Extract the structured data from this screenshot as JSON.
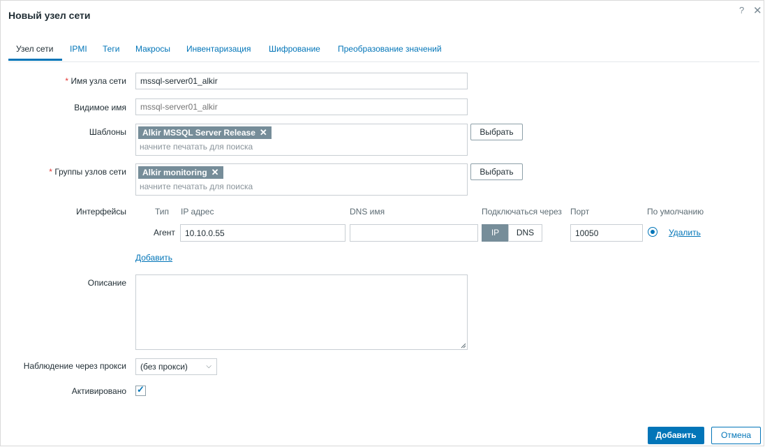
{
  "dialog": {
    "title": "Новый узел сети",
    "help_icon": "question-icon",
    "close_icon": "close-icon"
  },
  "tabs": [
    {
      "label": "Узел сети",
      "active": true
    },
    {
      "label": "IPMI"
    },
    {
      "label": "Теги"
    },
    {
      "label": "Макросы"
    },
    {
      "label": "Инвентаризация"
    },
    {
      "label": "Шифрование"
    },
    {
      "label": "Преобразование значений"
    }
  ],
  "form": {
    "required_mark": "*",
    "host_name": {
      "label": "Имя узла сети",
      "value": "mssql-server01_alkir"
    },
    "visible_name": {
      "label": "Видимое имя",
      "value": "mssql-server01_alkir"
    },
    "templates": {
      "label": "Шаблоны",
      "chip": "Alkir MSSQL Server Release",
      "placeholder": "начните печатать для поиска",
      "select_button": "Выбрать"
    },
    "host_groups": {
      "label": "Группы узлов сети",
      "chip": "Alkir monitoring",
      "placeholder": "начните печатать для поиска",
      "select_button": "Выбрать"
    },
    "interfaces": {
      "label": "Интерфейсы",
      "headers": {
        "type": "Тип",
        "ip": "IP адрес",
        "dns": "DNS имя",
        "connect": "Подключаться через",
        "port": "Порт",
        "default": "По умолчанию"
      },
      "row": {
        "type": "Агент",
        "ip": "10.10.0.55",
        "dns": "",
        "connect_ip": "IP",
        "connect_dns": "DNS",
        "connect_selected": "IP",
        "port": "10050",
        "remove": "Удалить"
      },
      "add_link": "Добавить"
    },
    "description": {
      "label": "Описание",
      "value": ""
    },
    "proxy": {
      "label": "Наблюдение через прокси",
      "value": "(без прокси)"
    },
    "enabled": {
      "label": "Активировано",
      "checked": true
    }
  },
  "footer": {
    "add_button": "Добавить",
    "cancel_button": "Отмена"
  },
  "colors": {
    "accent": "#0275b8",
    "chip": "#768d99",
    "required": "#e33734"
  }
}
